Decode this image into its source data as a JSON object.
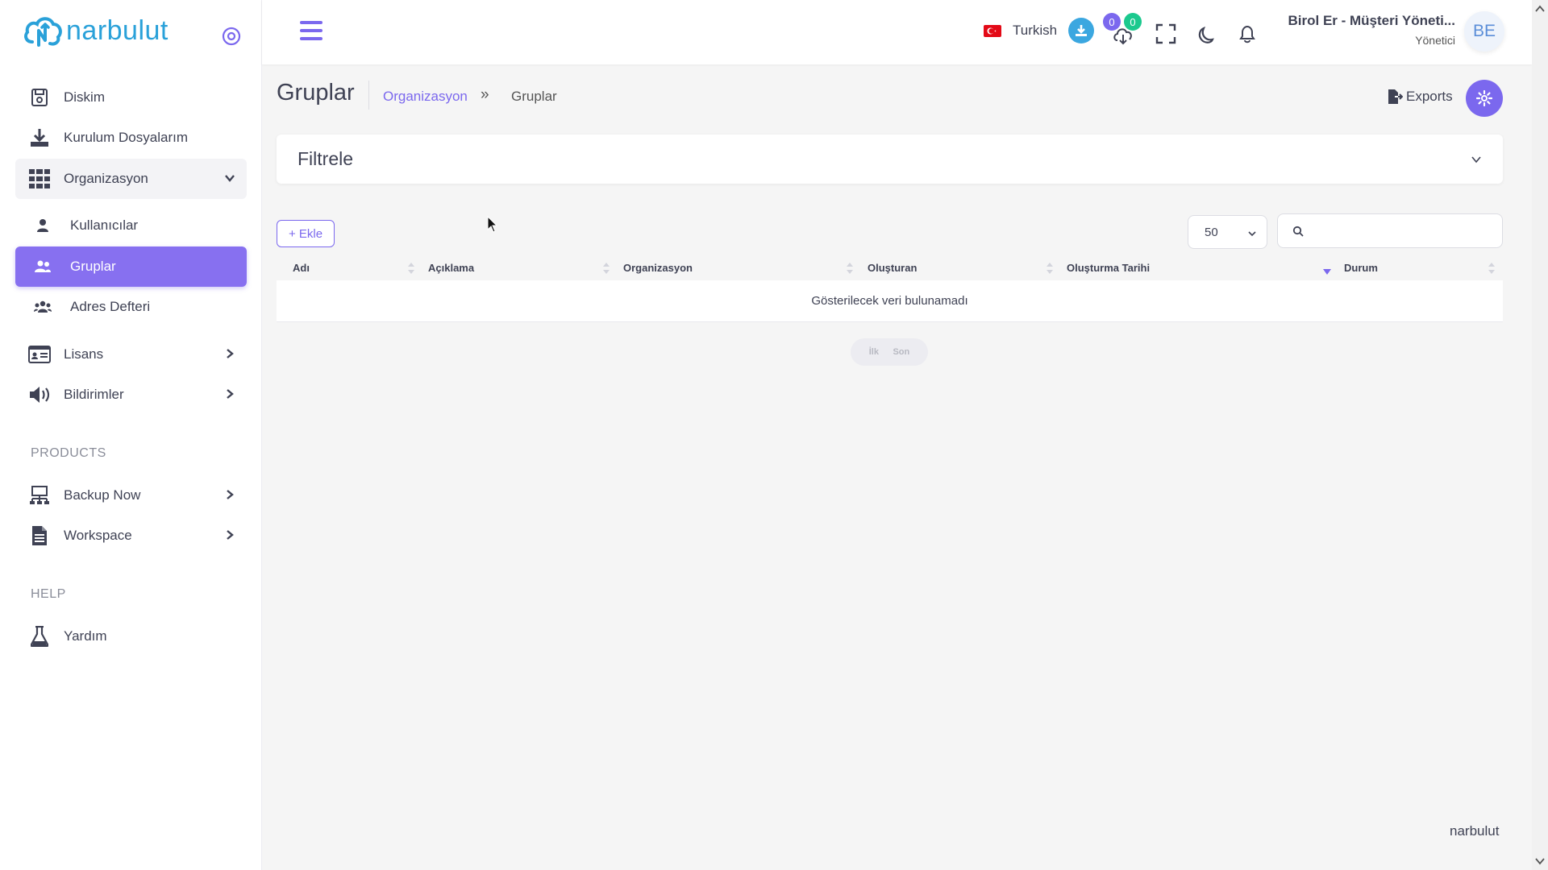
{
  "brand": {
    "name": "narbulut",
    "footer": "narbulut"
  },
  "sidebar": {
    "items": [
      {
        "label": "Diskim",
        "icon": "disk-icon"
      },
      {
        "label": "Kurulum Dosyalarım",
        "icon": "download-icon"
      },
      {
        "label": "Organizasyon",
        "icon": "grid-icon",
        "expanded": true
      },
      {
        "label": "Kullanıcılar",
        "icon": "user-icon"
      },
      {
        "label": "Gruplar",
        "icon": "users-icon",
        "active": true
      },
      {
        "label": "Adres Defteri",
        "icon": "address-book-icon"
      },
      {
        "label": "Lisans",
        "icon": "id-card-icon"
      },
      {
        "label": "Bildirimler",
        "icon": "megaphone-icon"
      },
      {
        "label": "Backup Now",
        "icon": "network-icon"
      },
      {
        "label": "Workspace",
        "icon": "document-icon"
      },
      {
        "label": "Yardım",
        "icon": "flask-icon"
      }
    ],
    "sections": {
      "products": "PRODUCTS",
      "help": "HELP"
    }
  },
  "topbar": {
    "language": "Turkish",
    "badge_upload": "0",
    "badge_download": "0",
    "user_name": "Birol Er - Müşteri Yöneti...",
    "user_role": "Yönetici",
    "avatar_initials": "BE"
  },
  "page": {
    "title": "Gruplar",
    "breadcrumb": {
      "parent": "Organizasyon",
      "separator": "»",
      "current": "Gruplar"
    },
    "exports_label": "Exports"
  },
  "filter": {
    "title": "Filtrele"
  },
  "table": {
    "add_label": "+ Ekle",
    "page_size": "50",
    "search_placeholder": "",
    "columns": [
      "Adı",
      "Açıklama",
      "Organizasyon",
      "Oluşturan",
      "Oluşturma Tarihi",
      "Durum"
    ],
    "empty_message": "Gösterilecek veri bulunamadı",
    "pager": {
      "first": "İlk",
      "last": "Son"
    }
  },
  "colors": {
    "accent": "#7b68ee",
    "brand": "#2aa1d9",
    "active_nav": "#8770f0"
  }
}
